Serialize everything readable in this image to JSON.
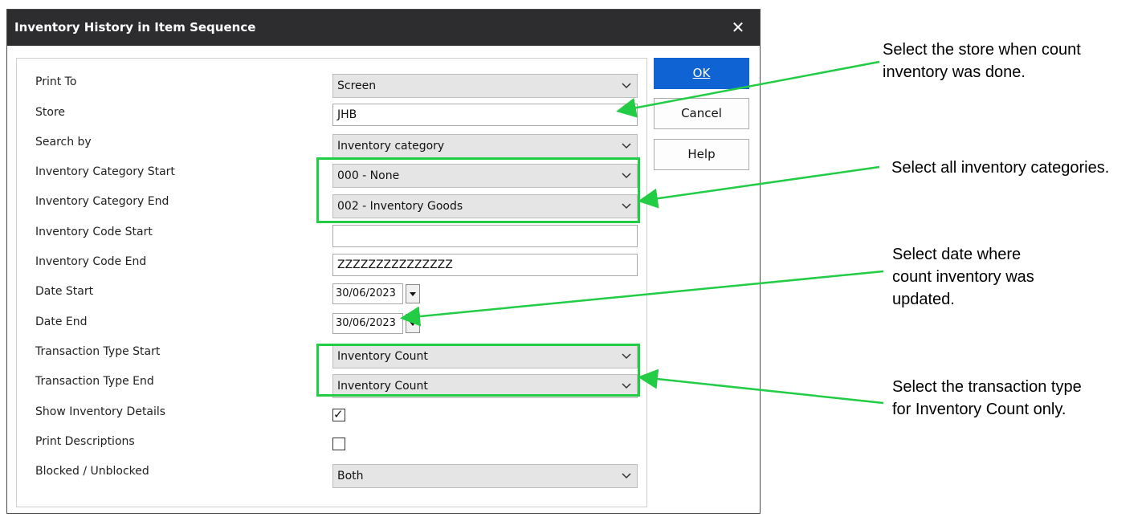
{
  "dialog": {
    "title": "Inventory History in Item Sequence",
    "close_symbol": "✕"
  },
  "fields": {
    "print_to": {
      "label": "Print To",
      "value": "Screen"
    },
    "store": {
      "label": "Store",
      "value": "JHB"
    },
    "search_by": {
      "label": "Search by",
      "value": "Inventory category"
    },
    "cat_start": {
      "label": "Inventory Category Start",
      "value": "000 - None"
    },
    "cat_end": {
      "label": "Inventory Category End",
      "value": "002 - Inventory Goods"
    },
    "code_start": {
      "label": "Inventory Code Start",
      "value": ""
    },
    "code_end": {
      "label": "Inventory Code End",
      "value": "ZZZZZZZZZZZZZZZ"
    },
    "date_start": {
      "label": "Date Start",
      "value": "30/06/2023"
    },
    "date_end": {
      "label": "Date End",
      "value": "30/06/2023"
    },
    "tt_start": {
      "label": "Transaction Type Start",
      "value": "Inventory Count"
    },
    "tt_end": {
      "label": "Transaction Type End",
      "value": "Inventory Count"
    },
    "show_details": {
      "label": "Show Inventory Details",
      "checked": true
    },
    "print_desc": {
      "label": "Print Descriptions",
      "checked": false
    },
    "blocked": {
      "label": "Blocked / Unblocked",
      "value": "Both"
    }
  },
  "buttons": {
    "ok": "OK",
    "cancel": "Cancel",
    "help": "Help"
  },
  "annotations": {
    "store_line1": "Select the store when count",
    "store_line2": "inventory was done.",
    "categories": "Select all inventory categories.",
    "date_line1": "Select date where",
    "date_line2": "count inventory was",
    "date_line3": "updated.",
    "tt_line1": "Select the transaction type",
    "tt_line2": "for Inventory Count only."
  },
  "colors": {
    "accent": "#0f63d2",
    "highlight": "#22cc44",
    "titlebar": "#2d2d30"
  },
  "icons": {
    "dropdown": "chevron-down-icon",
    "close": "close-icon",
    "check": "checkmark-icon"
  }
}
